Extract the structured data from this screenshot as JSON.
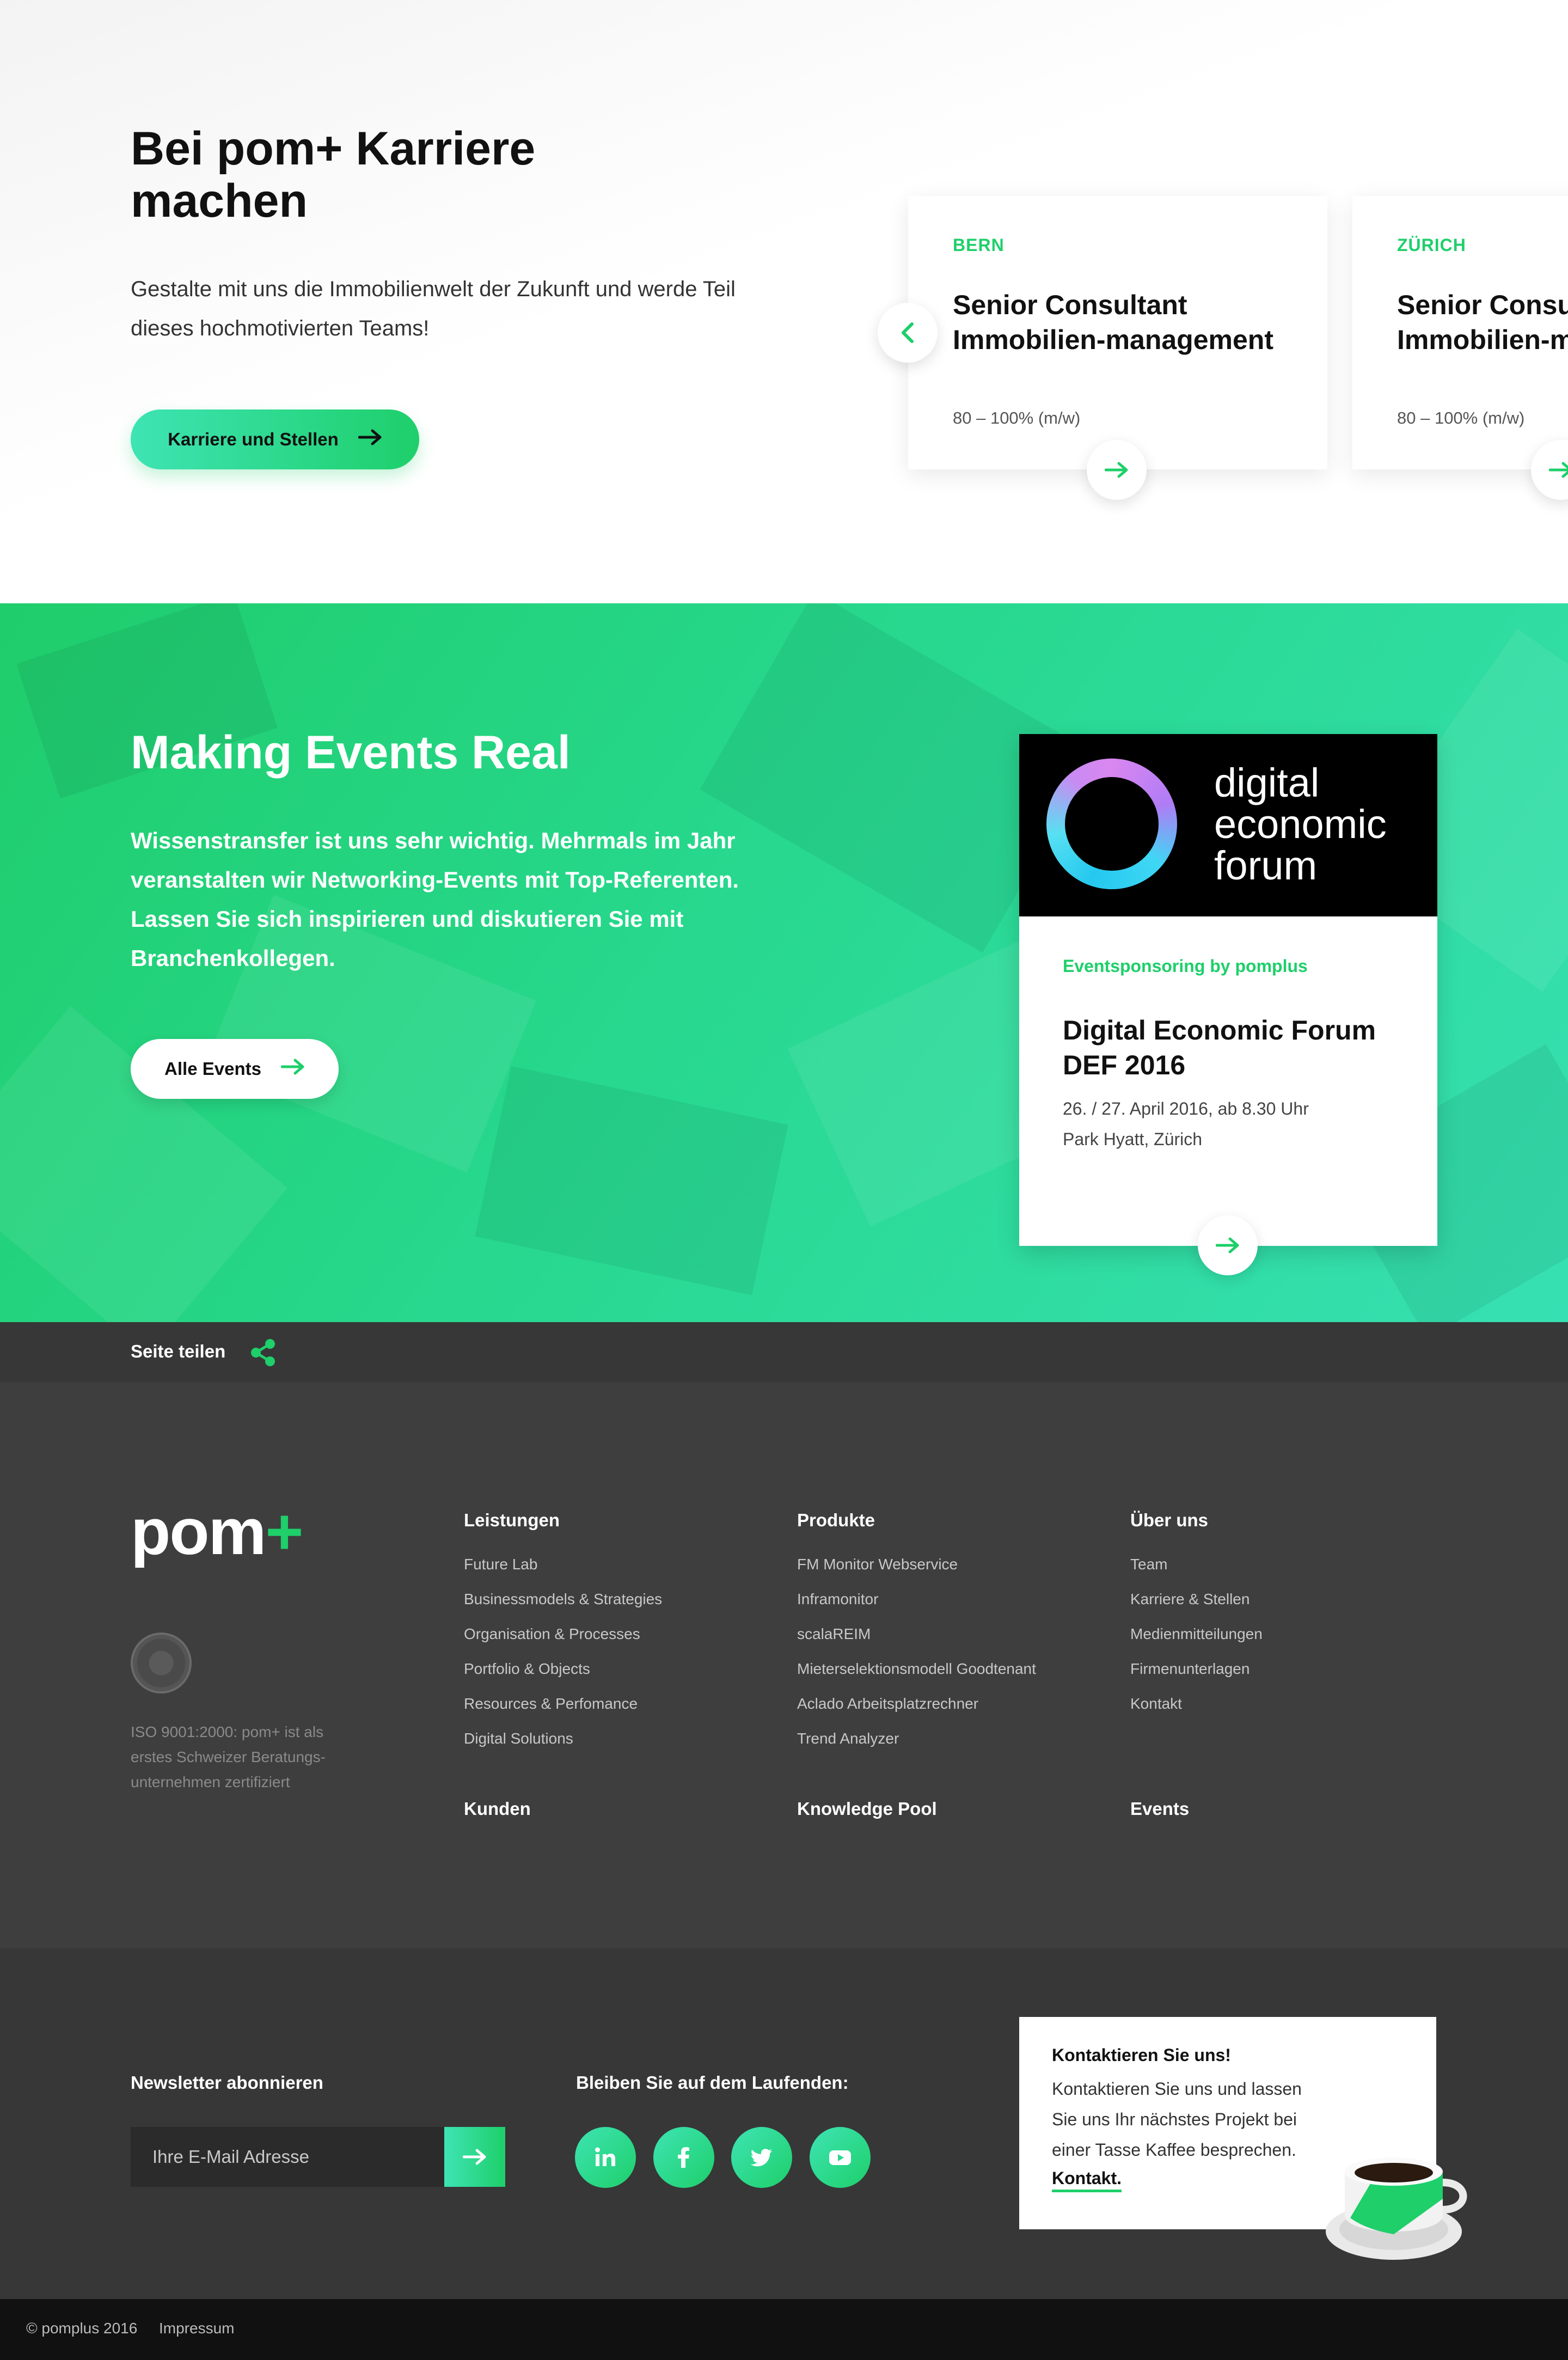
{
  "careers": {
    "title": "Bei pom+ Karriere machen",
    "text": "Gestalte mit uns die Immobilienwelt der Zukunft und werde Teil dieses hochmotivierten Teams!",
    "button_label": "Karriere und Stellen",
    "jobs": [
      {
        "location": "BERN",
        "title": "Senior Consultant Immobilien-management",
        "subtitle": "80 – 100% (m/w)"
      },
      {
        "location": "ZÜRICH",
        "title": "Senior Consultant Immobilien-management",
        "subtitle": "80 – 100% (m/w)"
      }
    ]
  },
  "events": {
    "title": "Making Events Real",
    "text": "Wissenstransfer ist uns sehr wichtig. Mehrmals im Jahr veranstalten wir Networking-Events mit Top-Referenten. Lassen Sie sich inspirieren und diskutieren Sie mit Branchenkollegen.",
    "button_label": "Alle Events",
    "card": {
      "logo_text_1": "digital",
      "logo_text_2": "economic",
      "logo_text_3": "forum",
      "kicker": "Eventsponsoring by pomplus",
      "title": "Digital Economic Forum DEF 2016",
      "date": "26. / 27. April 2016, ab 8.30 Uhr",
      "place": "Park Hyatt, Zürich"
    }
  },
  "share": {
    "label": "Seite teilen"
  },
  "footer": {
    "logo_main": "pom",
    "logo_plus": "+",
    "iso_text": "ISO 9001:2000: pom+ ist als erstes Schweizer Beratungs-unternehmen zertifiziert",
    "columns": [
      {
        "heading": "Leistungen",
        "links": [
          "Future Lab",
          "Businessmodels & Strategies",
          "Organisation & Processes",
          "Portfolio & Objects",
          "Resources & Perfomance",
          "Digital Solutions"
        ]
      },
      {
        "heading": "Produkte",
        "links": [
          "FM Monitor Webservice",
          "Inframonitor",
          "scalaREIM",
          "Mieterselektionsmodell Goodtenant",
          "Aclado Arbeitsplatzrechner",
          "Trend Analyzer"
        ]
      },
      {
        "heading": "Über uns",
        "links": [
          "Team",
          "Karriere & Stellen",
          "Medienmitteilungen",
          "Firmenunterlagen",
          "Kontakt"
        ]
      }
    ],
    "secondary": [
      "Kunden",
      "Knowledge Pool",
      "Events"
    ]
  },
  "newsletter": {
    "label": "Newsletter abonnieren",
    "placeholder": "Ihre E-Mail Adresse"
  },
  "social": {
    "label": "Bleiben Sie auf dem Laufenden:",
    "items": [
      "linkedin-icon",
      "facebook-icon",
      "twitter-icon",
      "youtube-icon"
    ]
  },
  "contact": {
    "title": "Kontaktieren Sie uns!",
    "text": "Kontaktieren Sie uns und lassen Sie uns Ihr nächstes Projekt bei einer Tasse Kaffee besprechen.",
    "link": "Kontakt."
  },
  "bottom": {
    "copyright": "© pomplus 2016",
    "impressum": "Impressum"
  },
  "colors": {
    "accent": "#1ecf6a",
    "accent_light": "#3ee4b4",
    "dark": "#3e3e3e",
    "darker": "#373737"
  }
}
